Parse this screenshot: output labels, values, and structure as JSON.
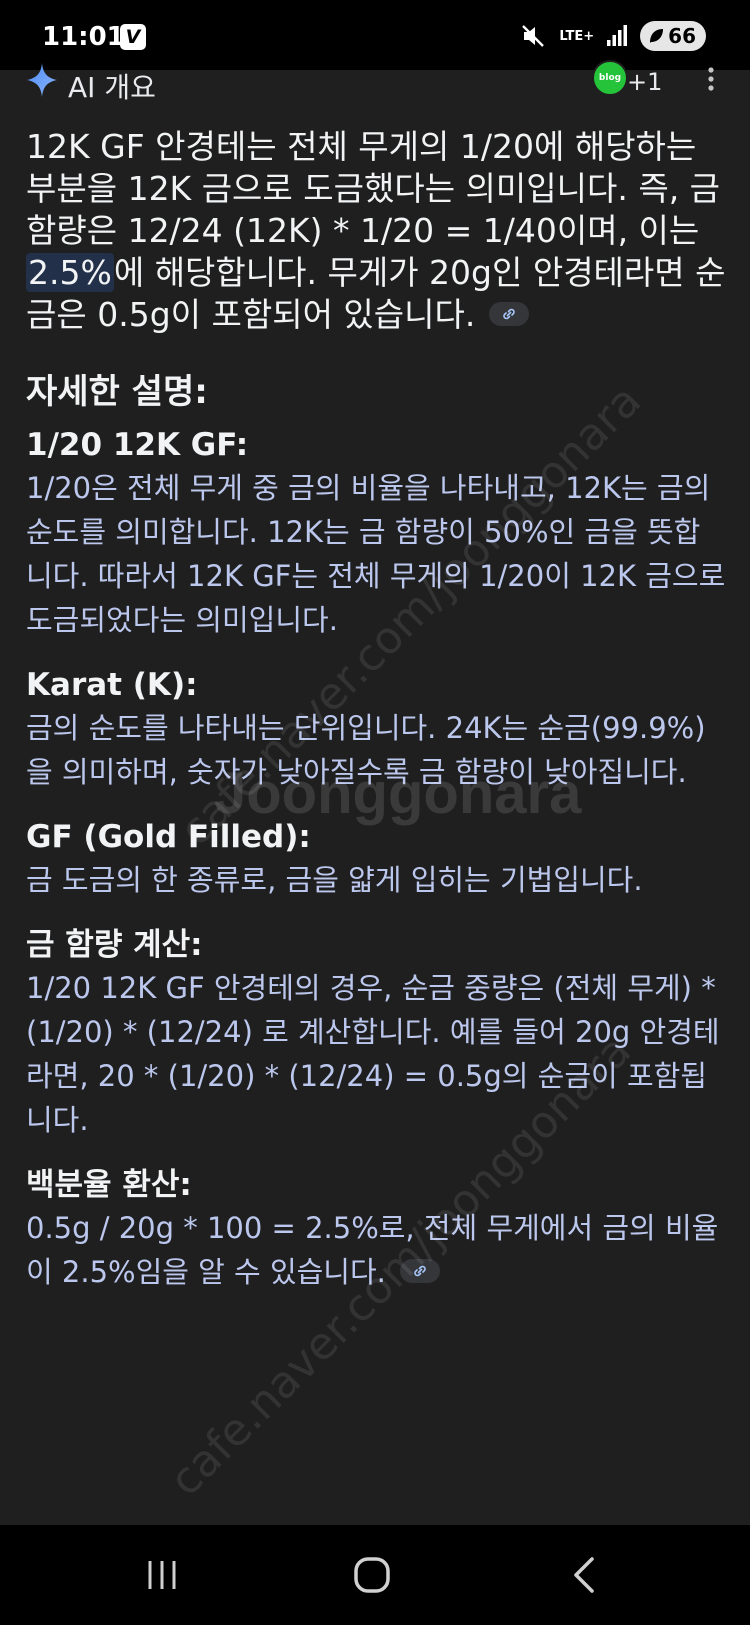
{
  "status_bar": {
    "time": "11:01",
    "app_icon": "V",
    "network": "LTE+",
    "battery": "66",
    "icons": [
      "mute-icon",
      "signal-icon",
      "leaf-icon"
    ]
  },
  "ai_overview": {
    "title": "AI 개요",
    "source_badge": "blog",
    "source_count": "+1",
    "icons": [
      "sparkle-icon",
      "more-vert-icon"
    ]
  },
  "summary": {
    "before": "12K GF 안경테는 전체 무게의 1/20에 해당하는 부분을 12K 금으로 도금했다는 의미입니다. 즉, 금 함량은 12/24 (12K) * 1/20 = 1/40이며, 이는 ",
    "highlight": "2.5%",
    "after": "에 해당합니다. 무게가 20g인 안경테라면 순금은 0.5g이 포함되어 있습니다."
  },
  "details": {
    "heading": "자세한 설명:",
    "items": [
      {
        "title": "1/20 12K GF:",
        "body": "1/20은 전체 무게 중 금의 비율을 나타내고, 12K는 금의 순도를 의미합니다. 12K는 금 함량이 50%인 금을 뜻합니다. 따라서 12K GF는 전체 무게의 1/20이 12K 금으로 도금되었다는 의미입니다."
      },
      {
        "title": "Karat (K):",
        "body": "금의 순도를 나타내는 단위입니다. 24K는 순금(99.9%)을 의미하며, 숫자가 낮아질수록 금 함량이 낮아집니다."
      },
      {
        "title": "GF (Gold Filled):",
        "body": "금 도금의 한 종류로, 금을 얇게 입히는 기법입니다."
      },
      {
        "title": "금 함량 계산:",
        "body": "1/20 12K GF 안경테의 경우, 순금 중량은 (전체 무게) * (1/20) * (12/24) 로 계산합니다. 예를 들어 20g 안경테라면, 20 * (1/20) * (12/24) = 0.5g의 순금이 포함됩니다."
      },
      {
        "title": "백분율 환산:",
        "body": "0.5g / 20g * 100 = 2.5%로, 전체 무게에서 금의 비율이 2.5%임을 알 수 있습니다."
      }
    ]
  },
  "watermark": {
    "main": "Joonggonara",
    "diagonal": "cafe.naver.com/joonggonara"
  },
  "nav_bar": {
    "icons": [
      "recent-apps-icon",
      "home-icon",
      "back-icon"
    ]
  }
}
